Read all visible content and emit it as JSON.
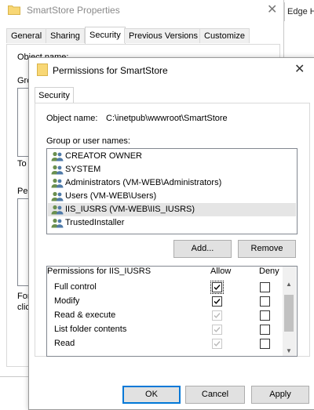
{
  "background_window": {
    "title": "SmartStore Properties",
    "tabs": [
      "General",
      "Sharing",
      "Security",
      "Previous Versions",
      "Customize"
    ],
    "active_tab": "Security",
    "fragments": {
      "object": "Object name:",
      "group": "Gro",
      "to": "To",
      "perm": "Per",
      "for1": "For",
      "for2": "clic"
    }
  },
  "edge_tab": {
    "label": "Edge H"
  },
  "dialog": {
    "title": "Permissions for SmartStore",
    "tab": "Security",
    "object_name_label": "Object name:",
    "object_name_value": "C:\\inetpub\\wwwroot\\SmartStore",
    "group_label": "Group or user names:",
    "groups": [
      {
        "name": "CREATOR OWNER",
        "selected": false
      },
      {
        "name": "SYSTEM",
        "selected": false
      },
      {
        "name": "Administrators (VM-WEB\\Administrators)",
        "selected": false
      },
      {
        "name": "Users (VM-WEB\\Users)",
        "selected": false
      },
      {
        "name": "IIS_IUSRS (VM-WEB\\IIS_IUSRS)",
        "selected": true
      },
      {
        "name": "TrustedInstaller",
        "selected": false
      }
    ],
    "add_button": "Add...",
    "remove_button": "Remove",
    "permissions_label": "Permissions for IIS_IUSRS",
    "allow_header": "Allow",
    "deny_header": "Deny",
    "permissions": [
      {
        "name": "Full control",
        "allow": true,
        "allow_disabled": false,
        "deny": false
      },
      {
        "name": "Modify",
        "allow": true,
        "allow_disabled": false,
        "deny": false
      },
      {
        "name": "Read & execute",
        "allow": true,
        "allow_disabled": true,
        "deny": false
      },
      {
        "name": "List folder contents",
        "allow": true,
        "allow_disabled": true,
        "deny": false
      },
      {
        "name": "Read",
        "allow": true,
        "allow_disabled": true,
        "deny": false
      }
    ],
    "ok_button": "OK",
    "cancel_button": "Cancel",
    "apply_button": "Apply"
  },
  "colors": {
    "accent": "#0078d7",
    "selection": "#e5e5e5",
    "folder": "#f8d775"
  }
}
